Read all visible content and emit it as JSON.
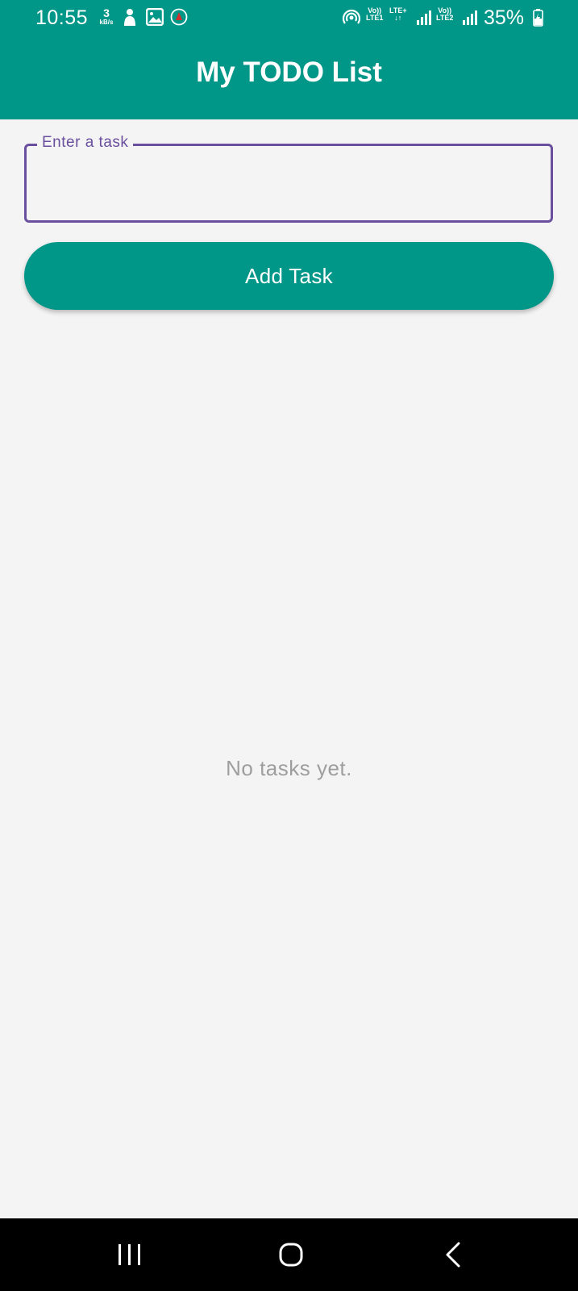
{
  "status_bar": {
    "time": "10:55",
    "net_speed_value": "3",
    "net_speed_unit": "kB/s",
    "sim1_label_top": "Vo))",
    "sim1_label_bottom": "LTE1",
    "network_type": "LTE+",
    "sim2_label_top": "Vo))",
    "sim2_label_bottom": "LTE2",
    "battery": "35%",
    "icons": [
      "notification-person-icon",
      "gallery-icon",
      "app-notification-icon",
      "hotspot-icon",
      "signal-icon",
      "battery-charging-icon"
    ]
  },
  "header": {
    "title": "My TODO List",
    "color": "#009688"
  },
  "task_input": {
    "label": "Enter a task",
    "value": "",
    "border_color": "#6a4f9e"
  },
  "add_button": {
    "label": "Add Task"
  },
  "task_list": {
    "empty_message": "No tasks yet."
  },
  "nav_bar": {
    "buttons": [
      "recent-apps-icon",
      "home-icon",
      "back-icon"
    ]
  }
}
